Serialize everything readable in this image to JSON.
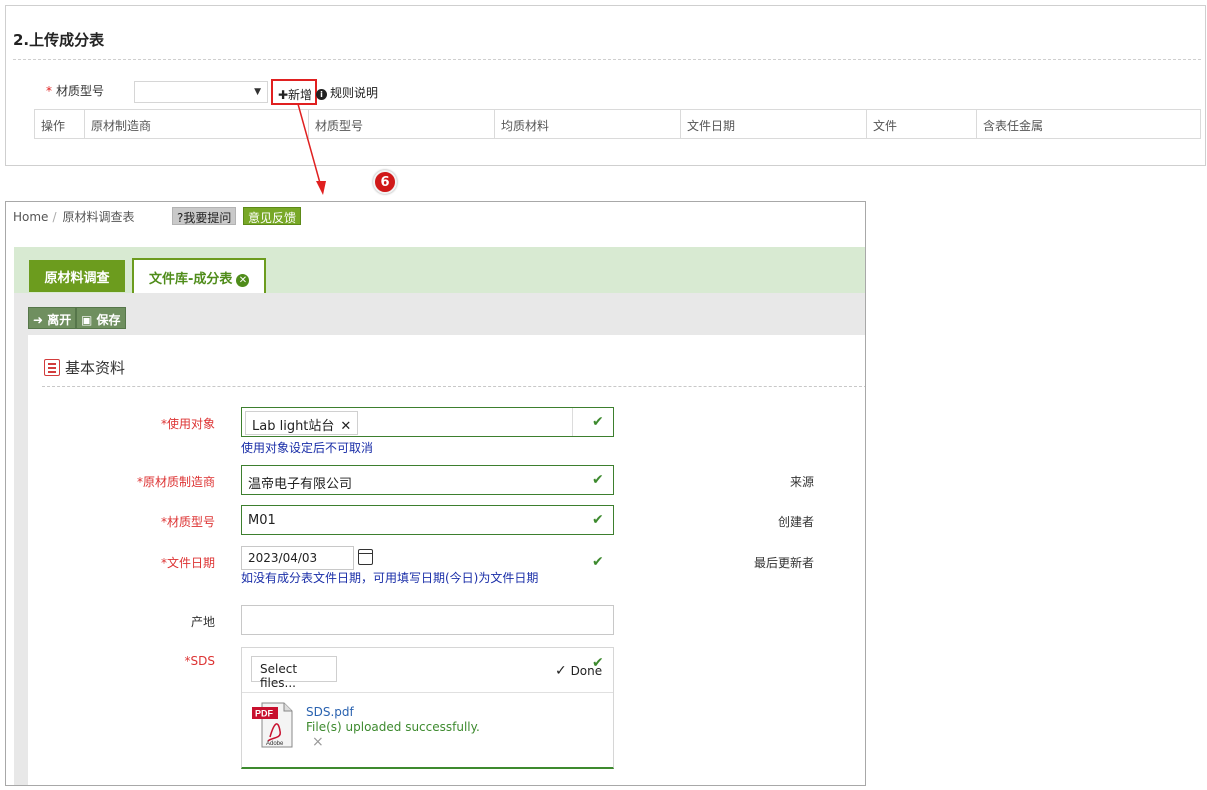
{
  "upload_section": {
    "title": "2.上传成分表",
    "material_label": "材质型号",
    "required_mark": "*",
    "add_button": "✚新增",
    "rules_link": "规则说明",
    "grid_columns": [
      "操作",
      "原材制造商",
      "材质型号",
      "均质材料",
      "文件日期",
      "文件",
      "含表任金属"
    ]
  },
  "step_marker": "6",
  "app": {
    "breadcrumb": {
      "home": "Home",
      "separator": "/",
      "current": "原材料调查表"
    },
    "help_badge": "?我要提问",
    "feedback_badge": "意见反馈",
    "tabs": [
      {
        "label": "原材料调查",
        "active": false
      },
      {
        "label": "文件库-成分表",
        "active": true
      }
    ],
    "toolbar": {
      "leave": "离开",
      "save": "保存"
    },
    "section_title": "基本资料",
    "form": {
      "target_label": "*使用对象",
      "target_tag": "Lab light站台",
      "target_hint": "使用对象设定后不可取消",
      "manufacturer_label": "*原材质制造商",
      "manufacturer_value": "温帝电子有限公司",
      "material_label": "*材质型号",
      "material_value": "M01",
      "date_label": "*文件日期",
      "date_value": "2023/04/03",
      "date_hint": "如没有成分表文件日期，可用填写日期(今日)为文件日期",
      "origin_label": "产地",
      "sds_label": "*SDS",
      "select_files": "Select files...",
      "done": "Done",
      "file_name": "SDS.pdf",
      "file_status": "File(s) uploaded successfully.",
      "remove_icon": "×",
      "pdf_badge": "PDF",
      "pdf_brand": "Adobe"
    },
    "right_labels": {
      "source": "来源",
      "creator": "创建者",
      "last_updater": "最后更新者"
    }
  },
  "colors": {
    "accent_green": "#6c9c1e",
    "valid_border": "#3d7f2e",
    "highlight_red": "#e02020",
    "hint_blue": "#1a2ea8"
  }
}
